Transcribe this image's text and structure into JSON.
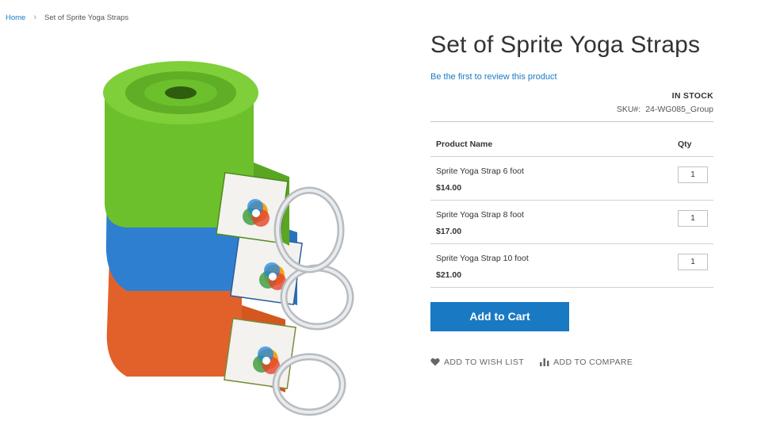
{
  "breadcrumb": {
    "home": "Home",
    "separator": "›",
    "current": "Set of Sprite Yoga Straps"
  },
  "product": {
    "title": "Set of Sprite Yoga Straps",
    "review_link": "Be the first to review this product",
    "stock": "IN STOCK",
    "sku_label": "SKU#:",
    "sku_value": "24-WG085_Group"
  },
  "table": {
    "col_name": "Product Name",
    "col_qty": "Qty",
    "items": [
      {
        "name": "Sprite Yoga Strap 6 foot",
        "price": "$14.00",
        "qty": "1"
      },
      {
        "name": "Sprite Yoga Strap 8 foot",
        "price": "$17.00",
        "qty": "1"
      },
      {
        "name": "Sprite Yoga Strap 10 foot",
        "price": "$21.00",
        "qty": "1"
      }
    ]
  },
  "buttons": {
    "add_to_cart": "Add to Cart"
  },
  "actions": {
    "wishlist": "ADD TO WISH LIST",
    "compare": "ADD TO COMPARE"
  },
  "colors": {
    "accent": "#1979c3",
    "strap_green": "#6cc02c",
    "strap_blue": "#2f7fd0",
    "strap_orange": "#e2612a"
  },
  "icons": {
    "wishlist": "heart-icon",
    "compare": "bar-chart-icon"
  }
}
